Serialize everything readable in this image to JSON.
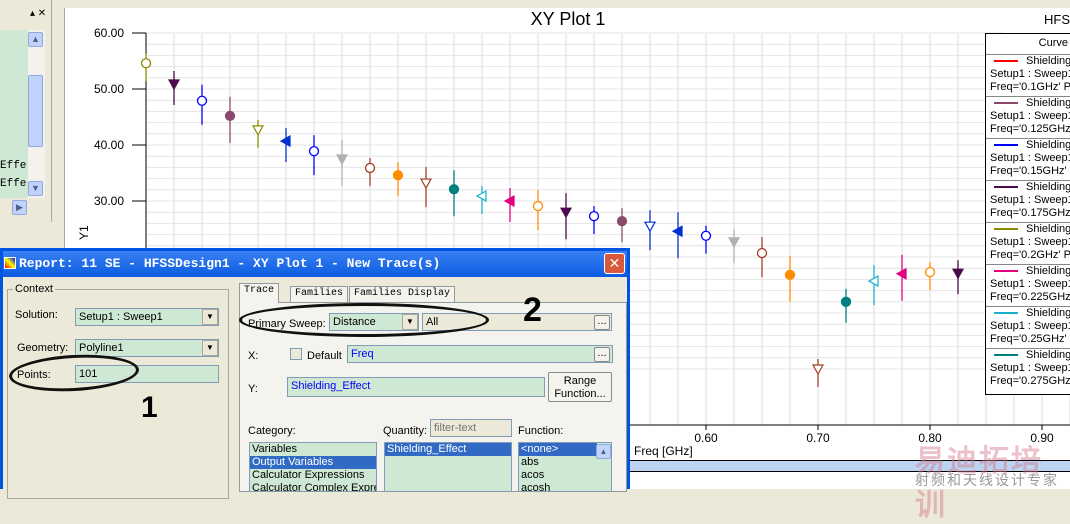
{
  "left_panel": {
    "items": [
      "Effe",
      "Effe"
    ]
  },
  "plot": {
    "title": "XY Plot 1",
    "corner": "HFS",
    "legend_header": "Curve",
    "legend": [
      {
        "l1": "Shielding",
        "l2": "Setup1 : Sweep1",
        "l3": "Freq='0.1GHz' P",
        "color": "#ff0000"
      },
      {
        "l1": "Shielding",
        "l2": "Setup1 : Sweep1",
        "l3": "Freq='0.125GHz",
        "color": "#8b4a6b"
      },
      {
        "l1": "Shielding",
        "l2": "Setup1 : Sweep1",
        "l3": "Freq='0.15GHz' I",
        "color": "#0000ff"
      },
      {
        "l1": "Shielding",
        "l2": "Setup1 : Sweep1",
        "l3": "Freq='0.175GHz",
        "color": "#4b0a4b"
      },
      {
        "l1": "Shielding",
        "l2": "Setup1 : Sweep1",
        "l3": "Freq='0.2GHz' P",
        "color": "#8b8b00"
      },
      {
        "l1": "Shielding",
        "l2": "Setup1 : Sweep1",
        "l3": "Freq='0.225GHz",
        "color": "#e0007f"
      },
      {
        "l1": "Shielding",
        "l2": "Setup1 : Sweep1",
        "l3": "Freq='0.25GHz' I",
        "color": "#1ab0c8"
      },
      {
        "l1": "Shielding",
        "l2": "Setup1 : Sweep1",
        "l3": "Freq='0.275GHz",
        "color": "#007f7f"
      }
    ]
  },
  "chart_data": {
    "type": "scatter",
    "title": "XY Plot 1",
    "xlabel": "Freq [GHz]",
    "ylabel": "Y1",
    "ylim": [
      20,
      60
    ],
    "xlim": [
      0.08,
      0.92
    ],
    "yticks": [
      "60.00",
      "50.00",
      "40.00",
      "30.00"
    ],
    "xticks": [
      "0.60",
      "0.70",
      "0.80",
      "0.90"
    ],
    "points": [
      {
        "x": 0.1,
        "y": 54.6,
        "c": "#8b8b00",
        "s": "o",
        "f": 0
      },
      {
        "x": 0.125,
        "y": 50.9,
        "c": "#4b0a4b",
        "s": "v",
        "f": 1
      },
      {
        "x": 0.15,
        "y": 47.9,
        "c": "#0000ff",
        "s": "o",
        "f": 0
      },
      {
        "x": 0.175,
        "y": 45.2,
        "c": "#8b4a6b",
        "s": "o",
        "f": 1
      },
      {
        "x": 0.2,
        "y": 42.7,
        "c": "#8b8b00",
        "s": "v",
        "f": 0
      },
      {
        "x": 0.225,
        "y": 40.7,
        "c": "#0030d0",
        "s": "<",
        "f": 1
      },
      {
        "x": 0.25,
        "y": 38.9,
        "c": "#0000ff",
        "s": "o",
        "f": 0
      },
      {
        "x": 0.275,
        "y": 37.5,
        "c": "#b0b0b0",
        "s": "v",
        "f": 1
      },
      {
        "x": 0.3,
        "y": 35.9,
        "c": "#a0402a",
        "s": "o",
        "f": 0
      },
      {
        "x": 0.325,
        "y": 34.6,
        "c": "#ff8c00",
        "s": "o",
        "f": 1
      },
      {
        "x": 0.35,
        "y": 33.2,
        "c": "#a0402a",
        "s": "v",
        "f": 0
      },
      {
        "x": 0.375,
        "y": 32.1,
        "c": "#008080",
        "s": "o",
        "f": 1
      },
      {
        "x": 0.4,
        "y": 30.9,
        "c": "#1ab0c8",
        "s": "<",
        "f": 0
      },
      {
        "x": 0.425,
        "y": 30.0,
        "c": "#e0007f",
        "s": "<",
        "f": 1
      },
      {
        "x": 0.45,
        "y": 29.1,
        "c": "#ff8c00",
        "s": "o",
        "f": 0
      },
      {
        "x": 0.475,
        "y": 28.0,
        "c": "#4b0a4b",
        "s": "v",
        "f": 1
      },
      {
        "x": 0.5,
        "y": 27.3,
        "c": "#0000ff",
        "s": "o",
        "f": 0
      },
      {
        "x": 0.525,
        "y": 26.4,
        "c": "#8b4a6b",
        "s": "o",
        "f": 1
      },
      {
        "x": 0.55,
        "y": 25.5,
        "c": "#0030d0",
        "s": "v",
        "f": 0
      },
      {
        "x": 0.575,
        "y": 24.6,
        "c": "#0030d0",
        "s": "<",
        "f": 1
      },
      {
        "x": 0.6,
        "y": 23.8,
        "c": "#0000ff",
        "s": "o",
        "f": 0
      },
      {
        "x": 0.625,
        "y": 22.7,
        "c": "#b0b0b0",
        "s": "v",
        "f": 1
      },
      {
        "x": 0.65,
        "y": 20.7,
        "c": "#a0402a",
        "s": "o",
        "f": 0
      },
      {
        "x": 0.675,
        "y": 16.8,
        "c": "#ff8c00",
        "s": "o",
        "f": 1
      },
      {
        "x": 0.7,
        "y": 0.0,
        "c": "#a0402a",
        "s": "v",
        "f": 0
      },
      {
        "x": 0.725,
        "y": 12.0,
        "c": "#008080",
        "s": "o",
        "f": 1
      },
      {
        "x": 0.75,
        "y": 15.7,
        "c": "#1ab0c8",
        "s": "<",
        "f": 0
      },
      {
        "x": 0.775,
        "y": 17.0,
        "c": "#e0007f",
        "s": "<",
        "f": 1
      },
      {
        "x": 0.8,
        "y": 17.3,
        "c": "#ff8c00",
        "s": "o",
        "f": 0
      },
      {
        "x": 0.825,
        "y": 17.1,
        "c": "#4b0a4b",
        "s": "v",
        "f": 1
      }
    ]
  },
  "dialog": {
    "title": "Report: 11 SE - HFSSDesign1 - XY Plot 1 - New Trace(s)",
    "context_label": "Context",
    "solution_label": "Solution:",
    "solution": "Setup1 : Sweep1",
    "geometry_label": "Geometry:",
    "geometry": "Polyline1",
    "points_label": "Points:",
    "points": "101",
    "tabs": [
      "Trace",
      "Families",
      "Families Display"
    ],
    "primary_sweep_label": "Primary Sweep:",
    "primary_sweep": "Distance",
    "sweep_values": "All",
    "x_label": "X:",
    "default_label": "Default",
    "x_value": "Freq",
    "y_label": "Y:",
    "y_value": "Shielding_Effect",
    "range_btn": "Range Function...",
    "ellipsis": "...",
    "category_label": "Category:",
    "categories": [
      "Variables",
      "Output Variables",
      "Calculator Expressions",
      "Calculator Complex Expre"
    ],
    "quantity_label": "Quantity:",
    "quantity_filter_placeholder": "filter-text",
    "quantities": [
      "Shielding_Effect"
    ],
    "function_label": "Function:",
    "functions": [
      "<none>",
      "abs",
      "acos",
      "acosh"
    ]
  },
  "annotations": {
    "n1": "1",
    "n2": "2"
  },
  "watermark": {
    "main": "易迪拓培训",
    "sub": "射频和天线设计专家"
  }
}
